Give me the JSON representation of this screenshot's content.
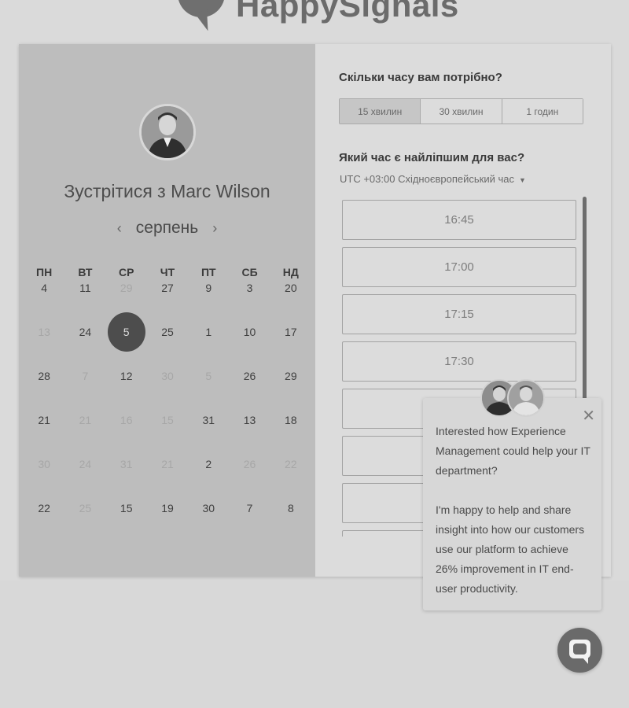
{
  "brand": {
    "name": "HappySignals"
  },
  "scheduler": {
    "meet_title": "Зустрітися з Marc Wilson",
    "month": "серпень",
    "prev_icon": "chevron-left-icon",
    "next_icon": "chevron-right-icon",
    "weekdays": [
      "ПН",
      "ВТ",
      "СР",
      "ЧТ",
      "ПТ",
      "СБ",
      "НД"
    ],
    "weeks": [
      [
        {
          "d": "4",
          "dim": false
        },
        {
          "d": "11",
          "dim": false
        },
        {
          "d": "29",
          "dim": true
        },
        {
          "d": "27",
          "dim": false
        },
        {
          "d": "9",
          "dim": false
        },
        {
          "d": "3",
          "dim": false
        },
        {
          "d": "20",
          "dim": false
        }
      ],
      [
        {
          "d": "13",
          "dim": true
        },
        {
          "d": "24",
          "dim": false
        },
        {
          "d": "5",
          "dim": false,
          "selected": true
        },
        {
          "d": "25",
          "dim": false
        },
        {
          "d": "1",
          "dim": false
        },
        {
          "d": "10",
          "dim": false
        },
        {
          "d": "17",
          "dim": false
        }
      ],
      [
        {
          "d": "28",
          "dim": false
        },
        {
          "d": "7",
          "dim": true
        },
        {
          "d": "12",
          "dim": false
        },
        {
          "d": "30",
          "dim": true
        },
        {
          "d": "5",
          "dim": true
        },
        {
          "d": "26",
          "dim": false
        },
        {
          "d": "29",
          "dim": false
        }
      ],
      [
        {
          "d": "21",
          "dim": false
        },
        {
          "d": "21",
          "dim": true
        },
        {
          "d": "16",
          "dim": true
        },
        {
          "d": "15",
          "dim": true
        },
        {
          "d": "31",
          "dim": false
        },
        {
          "d": "13",
          "dim": false
        },
        {
          "d": "18",
          "dim": false
        }
      ],
      [
        {
          "d": "30",
          "dim": true
        },
        {
          "d": "24",
          "dim": true
        },
        {
          "d": "31",
          "dim": true
        },
        {
          "d": "21",
          "dim": true
        },
        {
          "d": "2",
          "dim": false
        },
        {
          "d": "26",
          "dim": true
        },
        {
          "d": "22",
          "dim": true
        }
      ],
      [
        {
          "d": "22",
          "dim": false
        },
        {
          "d": "25",
          "dim": true
        },
        {
          "d": "15",
          "dim": false
        },
        {
          "d": "19",
          "dim": false
        },
        {
          "d": "30",
          "dim": false
        },
        {
          "d": "7",
          "dim": false
        },
        {
          "d": "8",
          "dim": false
        }
      ]
    ],
    "duration_question": "Скільки часу вам потрібно?",
    "durations": [
      {
        "label": "15 хвилин",
        "active": true
      },
      {
        "label": "30 хвилин",
        "active": false
      },
      {
        "label": "1 годин",
        "active": false
      }
    ],
    "time_question": "Який час є найліпшим для вас?",
    "timezone": "UTC +03:00 Східноєвропейський час",
    "timezone_icon": "caret-down-icon",
    "slots": [
      "16:45",
      "17:00",
      "17:15",
      "17:30",
      "",
      "",
      "",
      ""
    ]
  },
  "chat_popup": {
    "close_icon": "close-icon",
    "message_1": "Interested how Experience Management could help your IT department?",
    "message_2": "I'm happy to help and share insight into how our customers use our platform to achieve 26% improvement in IT end-user productivity."
  },
  "chat_launcher": {
    "icon": "chat-bubble-icon"
  }
}
